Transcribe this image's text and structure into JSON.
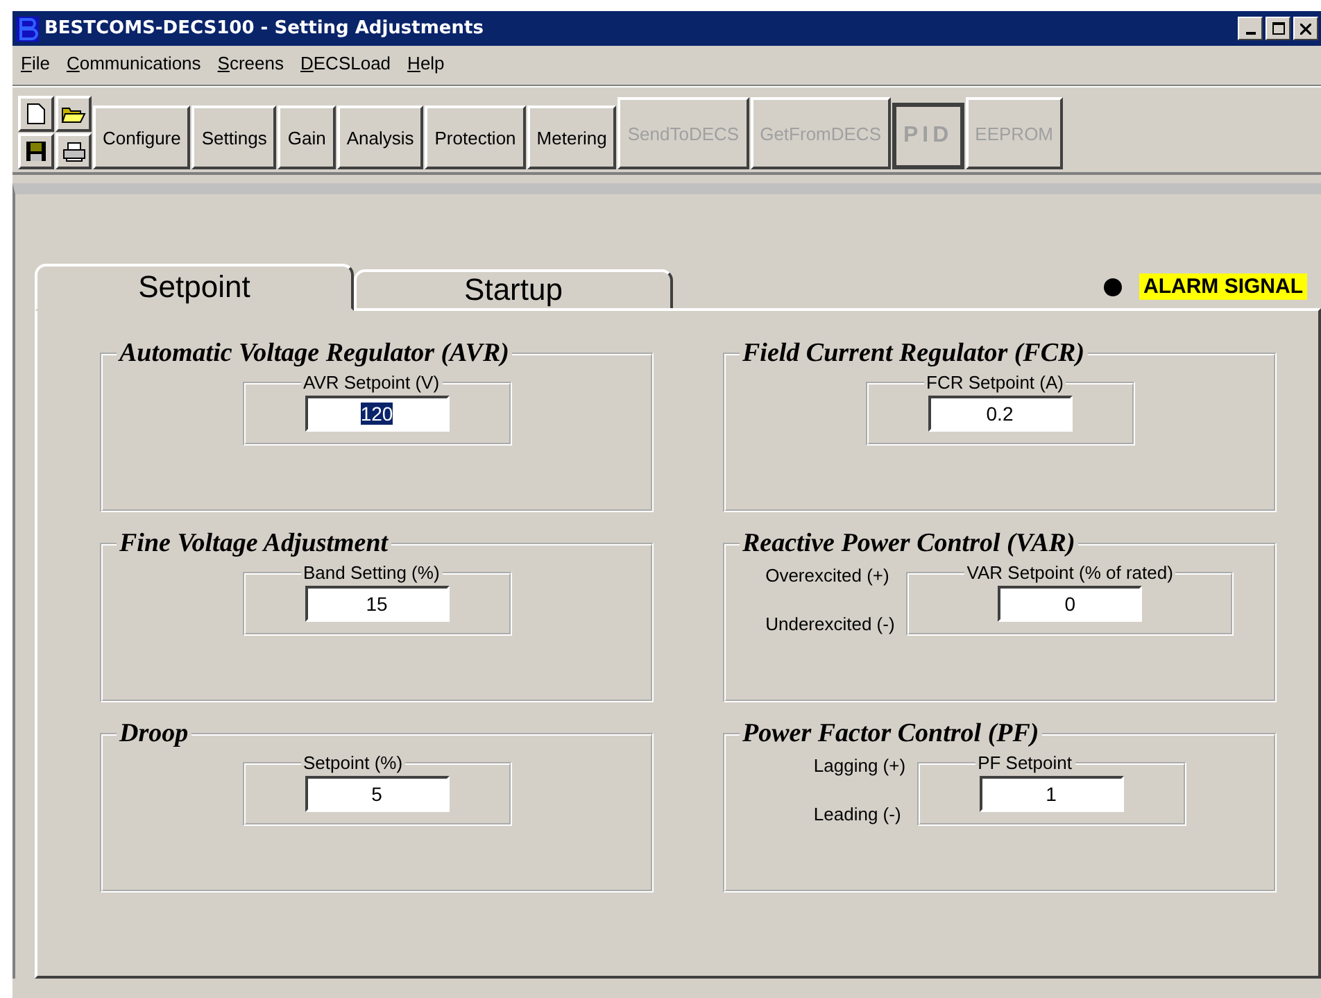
{
  "window": {
    "title": "BESTCOMS-DECS100 - Setting Adjustments"
  },
  "menu": [
    "File",
    "Communications",
    "Screens",
    "DECSLoad",
    "Help"
  ],
  "toolbar": {
    "buttons": [
      {
        "label": "Configure",
        "kind": "normal",
        "disabled": false
      },
      {
        "label": "Settings",
        "kind": "normal",
        "disabled": false
      },
      {
        "label": "Gain",
        "kind": "normal",
        "disabled": false
      },
      {
        "label": "Analysis",
        "kind": "normal",
        "disabled": false
      },
      {
        "label": "Protection",
        "kind": "normal",
        "disabled": false
      },
      {
        "label": "Metering",
        "kind": "normal",
        "disabled": false
      },
      {
        "label": "SendToDECS",
        "kind": "normal",
        "disabled": true
      },
      {
        "label": "GetFromDECS",
        "kind": "normal",
        "disabled": true
      },
      {
        "label": "PID",
        "kind": "heavy",
        "disabled": true
      },
      {
        "label": "EEPROM",
        "kind": "normal",
        "disabled": true
      }
    ]
  },
  "tabs": [
    {
      "label": "Setpoint",
      "selected": true
    },
    {
      "label": "Startup",
      "selected": false
    }
  ],
  "alarm": {
    "label": "ALARM SIGNAL"
  },
  "columns": [
    [
      {
        "title": "Automatic Voltage Regulator (AVR)",
        "field": {
          "label": "AVR Setpoint (V)",
          "value": "120",
          "selected": true
        }
      },
      {
        "title": "Fine Voltage Adjustment",
        "field": {
          "label": "Band Setting (%)",
          "value": "15",
          "selected": false
        }
      },
      {
        "title": "Droop",
        "field": {
          "label": "Setpoint (%)",
          "value": "5",
          "selected": false
        }
      }
    ],
    [
      {
        "title": "Field Current Regulator (FCR)",
        "field": {
          "label": "FCR Setpoint (A)",
          "value": "0.2",
          "selected": false
        }
      },
      {
        "title": "Reactive Power Control (VAR)",
        "side_labels": [
          "Overexcited (+)",
          "Underexcited (-)"
        ],
        "field": {
          "label": "VAR Setpoint (% of rated)",
          "value": "0",
          "selected": false
        }
      },
      {
        "title": "Power Factor Control (PF)",
        "side_labels": [
          "Lagging (+)",
          "Leading (-)"
        ],
        "field": {
          "label": "PF Setpoint",
          "value": "1",
          "selected": false
        }
      }
    ]
  ]
}
